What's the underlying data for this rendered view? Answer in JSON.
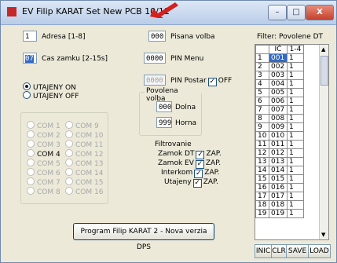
{
  "window": {
    "title": "EV Filip KARAT Set New PCB 10/11",
    "minimize": "–",
    "maximize": "□",
    "close": "X"
  },
  "address": {
    "value": "1",
    "label": "Adresa [1-8]"
  },
  "lock_time": {
    "value": "07",
    "label": "Cas zamku [2-15s]"
  },
  "hidden_on": "UTAJENY ON",
  "hidden_off": "UTAJENY OFF",
  "com_ports": [
    "COM 1",
    "COM 2",
    "COM 3",
    "COM 4",
    "COM 5",
    "COM 6",
    "COM 7",
    "COM 8",
    "COM 9",
    "COM 10",
    "COM 11",
    "COM 12",
    "COM 13",
    "COM 14",
    "COM 15",
    "COM 16"
  ],
  "pisana_volba": {
    "value": "000",
    "label": "Pisana volba"
  },
  "pin_menu": {
    "value": "0000",
    "label": "PIN Menu"
  },
  "pin_postar": {
    "value": "0000",
    "label": "PIN Postar",
    "off_label": "OFF"
  },
  "povolena_volba": {
    "label": "Povolena volba",
    "dolna_value": "000",
    "dolna_label": "Dolna",
    "horna_value": "999",
    "horna_label": "Horna"
  },
  "filtrovanie": {
    "label": "Filtrovanie",
    "rows": [
      {
        "label": "Zamok DT",
        "state": "ZAP."
      },
      {
        "label": "Zamok EV",
        "state": "ZAP."
      },
      {
        "label": "Interkom",
        "state": "ZAP."
      },
      {
        "label": "Utajeny",
        "state": "ZAP."
      }
    ]
  },
  "program_button": "Program Filip KARAT 2 - Nova verzia DPS",
  "filter_title": "Filter: Povolene DT",
  "grid": {
    "headers": [
      "",
      "IČ",
      "1-4"
    ],
    "rows": [
      [
        "1",
        "001",
        "1"
      ],
      [
        "2",
        "002",
        "1"
      ],
      [
        "3",
        "003",
        "1"
      ],
      [
        "4",
        "004",
        "1"
      ],
      [
        "5",
        "005",
        "1"
      ],
      [
        "6",
        "006",
        "1"
      ],
      [
        "7",
        "007",
        "1"
      ],
      [
        "8",
        "008",
        "1"
      ],
      [
        "9",
        "009",
        "1"
      ],
      [
        "10",
        "010",
        "1"
      ],
      [
        "11",
        "011",
        "1"
      ],
      [
        "12",
        "012",
        "1"
      ],
      [
        "13",
        "013",
        "1"
      ],
      [
        "14",
        "014",
        "1"
      ],
      [
        "15",
        "015",
        "1"
      ],
      [
        "16",
        "016",
        "1"
      ],
      [
        "17",
        "017",
        "1"
      ],
      [
        "18",
        "018",
        "1"
      ],
      [
        "19",
        "019",
        "1"
      ]
    ]
  },
  "bottom_buttons": [
    "INIC",
    "CLR",
    "SAVE",
    "LOAD"
  ]
}
